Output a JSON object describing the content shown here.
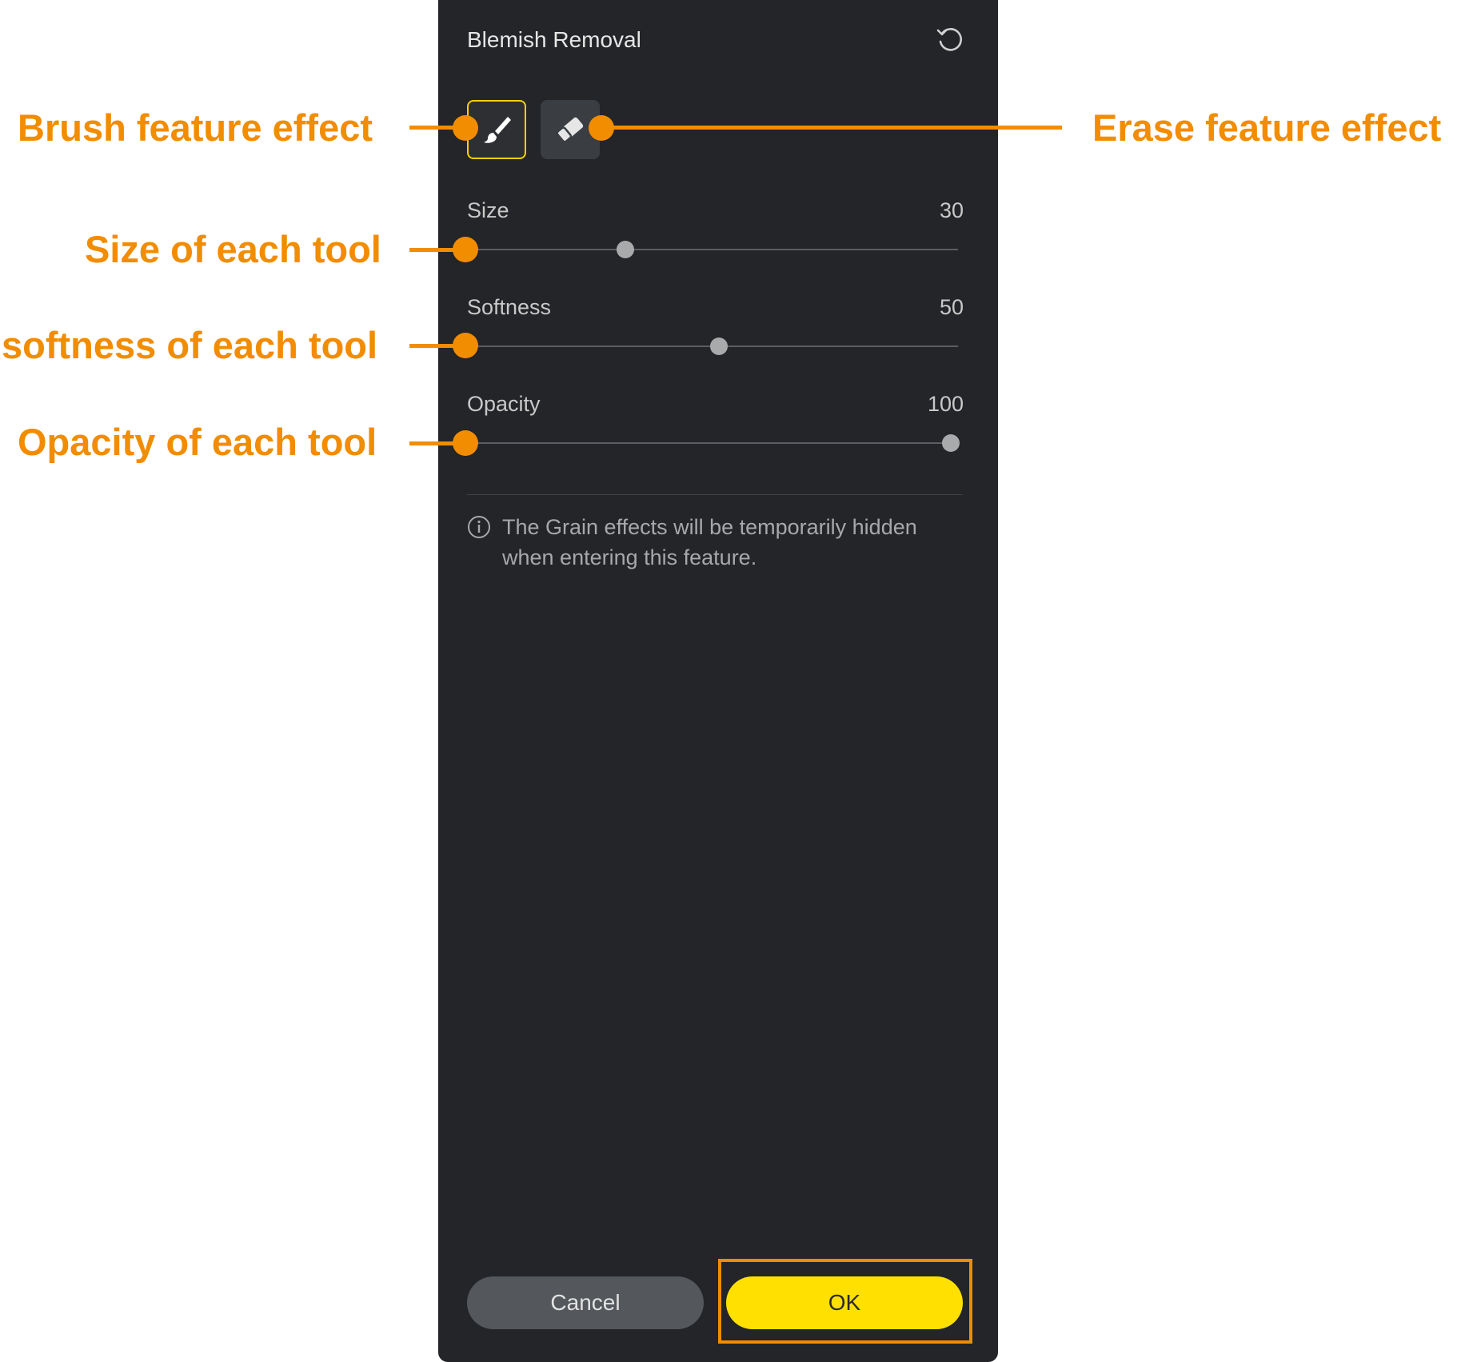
{
  "panel": {
    "title": "Blemish Removal",
    "reset_icon": "reset-icon",
    "tools": [
      {
        "name": "brush",
        "icon": "brush-icon",
        "selected": true
      },
      {
        "name": "erase",
        "icon": "eraser-icon",
        "selected": false
      }
    ],
    "sliders": [
      {
        "label": "Size",
        "value": "30",
        "level": 0.3
      },
      {
        "label": "Softness",
        "value": "50",
        "level": 0.5
      },
      {
        "label": "Opacity",
        "value": "100",
        "level": 1.0
      }
    ],
    "info": {
      "icon": "info-icon",
      "text": "The Grain effects will be temporarily hidden when entering this feature."
    },
    "buttons": {
      "cancel_label": "Cancel",
      "ok_label": "OK"
    }
  },
  "annotations": {
    "brush": "Brush feature effect",
    "erase": "Erase feature effect",
    "size": "Size of each tool",
    "softness": "softness of each tool",
    "opacity": "Opacity of each tool"
  },
  "colors": {
    "panel_bg": "#232528",
    "accent_yellow": "#ffe000",
    "annotation_orange": "#f28c00"
  }
}
